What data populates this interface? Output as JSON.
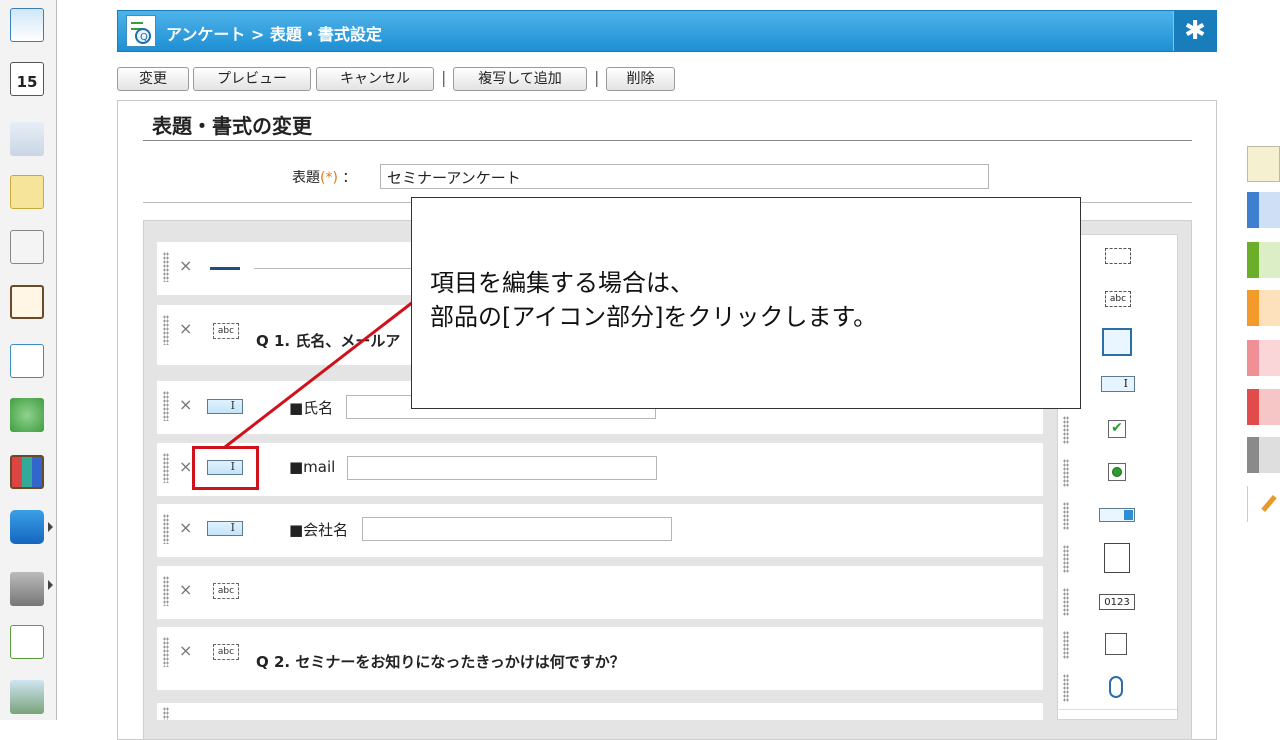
{
  "header": {
    "title": "アンケート > 表題・書式設定"
  },
  "toolbar": {
    "change": "変更",
    "preview": "プレビュー",
    "cancel": "キャンセル",
    "sep": "|",
    "copy_add": "複写して追加",
    "delete": "削除"
  },
  "form": {
    "panel_title": "表題・書式の変更",
    "title_label": "表題",
    "required_mark": "(*)",
    "colon": "：",
    "title_value": "セミナーアンケート"
  },
  "rows": [
    {
      "type": "separator",
      "label": ""
    },
    {
      "type": "text",
      "label": "Q 1. 氏名、メールア"
    },
    {
      "type": "input",
      "label": "■氏名"
    },
    {
      "type": "input",
      "label": "■mail"
    },
    {
      "type": "input",
      "label": "■会社名"
    },
    {
      "type": "text",
      "label": ""
    },
    {
      "type": "text",
      "label": "Q 2. セミナーをお知りになったきっかけは何ですか？"
    }
  ],
  "icons": {
    "close": "×",
    "abc": "abc",
    "text_cursor": "I",
    "gear": "✱",
    "calendar_day": "15",
    "palette_number": "0123"
  },
  "callout": {
    "line1": "項目を編集する場合は、",
    "line2": "部品の[アイコン部分]をクリックします。"
  },
  "colors": {
    "header": "#2a9de0",
    "highlight": "#d0101b",
    "required": "#e07a1c"
  }
}
